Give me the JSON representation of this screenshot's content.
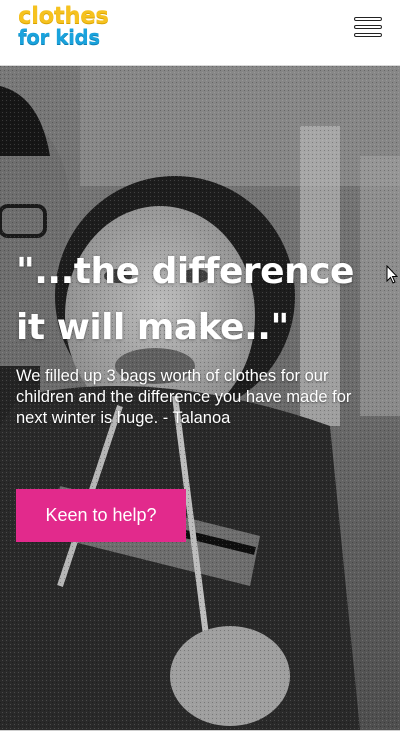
{
  "header": {
    "logo_line1": "clothes",
    "logo_line2": "for kids",
    "menu_icon": "hamburger-menu-icon"
  },
  "hero": {
    "image": "grayscale-photo-child-smiling",
    "title": "\"...the difference it will make..\"",
    "quote": "We filled up 3 bags worth of clothes for our children and the difference you have made for next winter is huge. - Talanoa",
    "cta_label": "Keen to help?"
  },
  "colors": {
    "logo_yellow": "#f6c21f",
    "logo_blue": "#1aa3dd",
    "cta_pink": "#e22a8c",
    "title_white": "#ffffff"
  }
}
